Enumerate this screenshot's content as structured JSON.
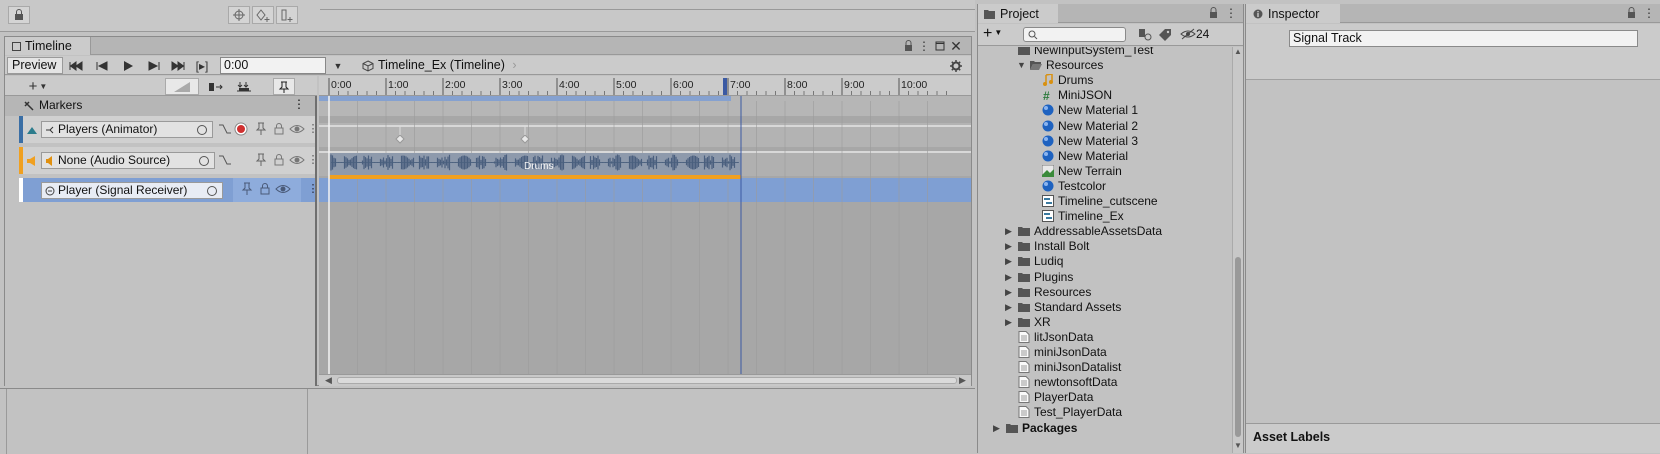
{
  "timeline": {
    "tab_label": "Timeline",
    "preview_label": "Preview",
    "frame_btn_label": "[▸]",
    "time_value": "0:00",
    "breadcrumb": "Timeline_Ex (Timeline)",
    "markers_label": "Markers",
    "ruler_ticks": [
      "0:00",
      "1:00",
      "2:00",
      "3:00",
      "4:00",
      "5:00",
      "6:00",
      "7:00",
      "8:00",
      "9:00",
      "10:00"
    ],
    "tracks": [
      {
        "label": "Players (Animator)",
        "accent": "#3a6ea5"
      },
      {
        "label": "None (Audio Source)",
        "accent": "#f0a020"
      },
      {
        "label": "Player (Signal Receiver)",
        "accent": "#ffffff"
      }
    ],
    "clip_label": "Drums",
    "colors": {
      "selection": "#7f9fd3",
      "audio_clip": "#8e9aac",
      "waveform": "#4a5f7e",
      "audio_bar": "#f0a020",
      "playhead": "#3b5aa3"
    }
  },
  "project": {
    "tab_label": "Project",
    "hidden_count": "24",
    "items": [
      {
        "label": "NewInputSystem_Test",
        "icon": "folder-icon",
        "indent": 1,
        "arrow": ""
      },
      {
        "label": "Resources",
        "icon": "folder-open-icon",
        "indent": 2,
        "arrow": "▼"
      },
      {
        "label": "Drums",
        "icon": "audio-icon",
        "indent": 3,
        "arrow": ""
      },
      {
        "label": "MiniJSON",
        "icon": "script-icon",
        "indent": 3,
        "arrow": ""
      },
      {
        "label": "New Material 1",
        "icon": "material-icon",
        "indent": 3,
        "arrow": ""
      },
      {
        "label": "New Material 2",
        "icon": "material-icon",
        "indent": 3,
        "arrow": ""
      },
      {
        "label": "New Material 3",
        "icon": "material-icon",
        "indent": 3,
        "arrow": ""
      },
      {
        "label": "New Material",
        "icon": "material-icon",
        "indent": 3,
        "arrow": ""
      },
      {
        "label": "New Terrain",
        "icon": "terrain-icon",
        "indent": 3,
        "arrow": ""
      },
      {
        "label": "Testcolor",
        "icon": "material-icon",
        "indent": 3,
        "arrow": ""
      },
      {
        "label": "Timeline_cutscene",
        "icon": "timeline-icon",
        "indent": 3,
        "arrow": ""
      },
      {
        "label": "Timeline_Ex",
        "icon": "timeline-icon",
        "indent": 3,
        "arrow": ""
      },
      {
        "label": "AddressableAssetsData",
        "icon": "folder-icon",
        "indent": 1,
        "arrow": "▶"
      },
      {
        "label": "Install Bolt",
        "icon": "folder-icon",
        "indent": 1,
        "arrow": "▶"
      },
      {
        "label": "Ludiq",
        "icon": "folder-icon",
        "indent": 1,
        "arrow": "▶"
      },
      {
        "label": "Plugins",
        "icon": "folder-icon",
        "indent": 1,
        "arrow": "▶"
      },
      {
        "label": "Resources",
        "icon": "folder-icon",
        "indent": 1,
        "arrow": "▶"
      },
      {
        "label": "Standard Assets",
        "icon": "folder-icon",
        "indent": 1,
        "arrow": "▶"
      },
      {
        "label": "XR",
        "icon": "folder-icon",
        "indent": 1,
        "arrow": "▶"
      },
      {
        "label": "litJsonData",
        "icon": "text-file-icon",
        "indent": 1,
        "arrow": ""
      },
      {
        "label": "miniJsonData",
        "icon": "text-file-icon",
        "indent": 1,
        "arrow": ""
      },
      {
        "label": "miniJsonDatalist",
        "icon": "text-file-icon",
        "indent": 1,
        "arrow": ""
      },
      {
        "label": "newtonsoftData",
        "icon": "text-file-icon",
        "indent": 1,
        "arrow": ""
      },
      {
        "label": "PlayerData",
        "icon": "text-file-icon",
        "indent": 1,
        "arrow": ""
      },
      {
        "label": "Test_PlayerData",
        "icon": "text-file-icon",
        "indent": 1,
        "arrow": ""
      },
      {
        "label": "Packages",
        "icon": "folder-icon",
        "indent": 0,
        "arrow": "▶"
      }
    ]
  },
  "inspector": {
    "tab_label": "Inspector",
    "object_name": "Signal Track",
    "asset_labels": "Asset Labels"
  }
}
